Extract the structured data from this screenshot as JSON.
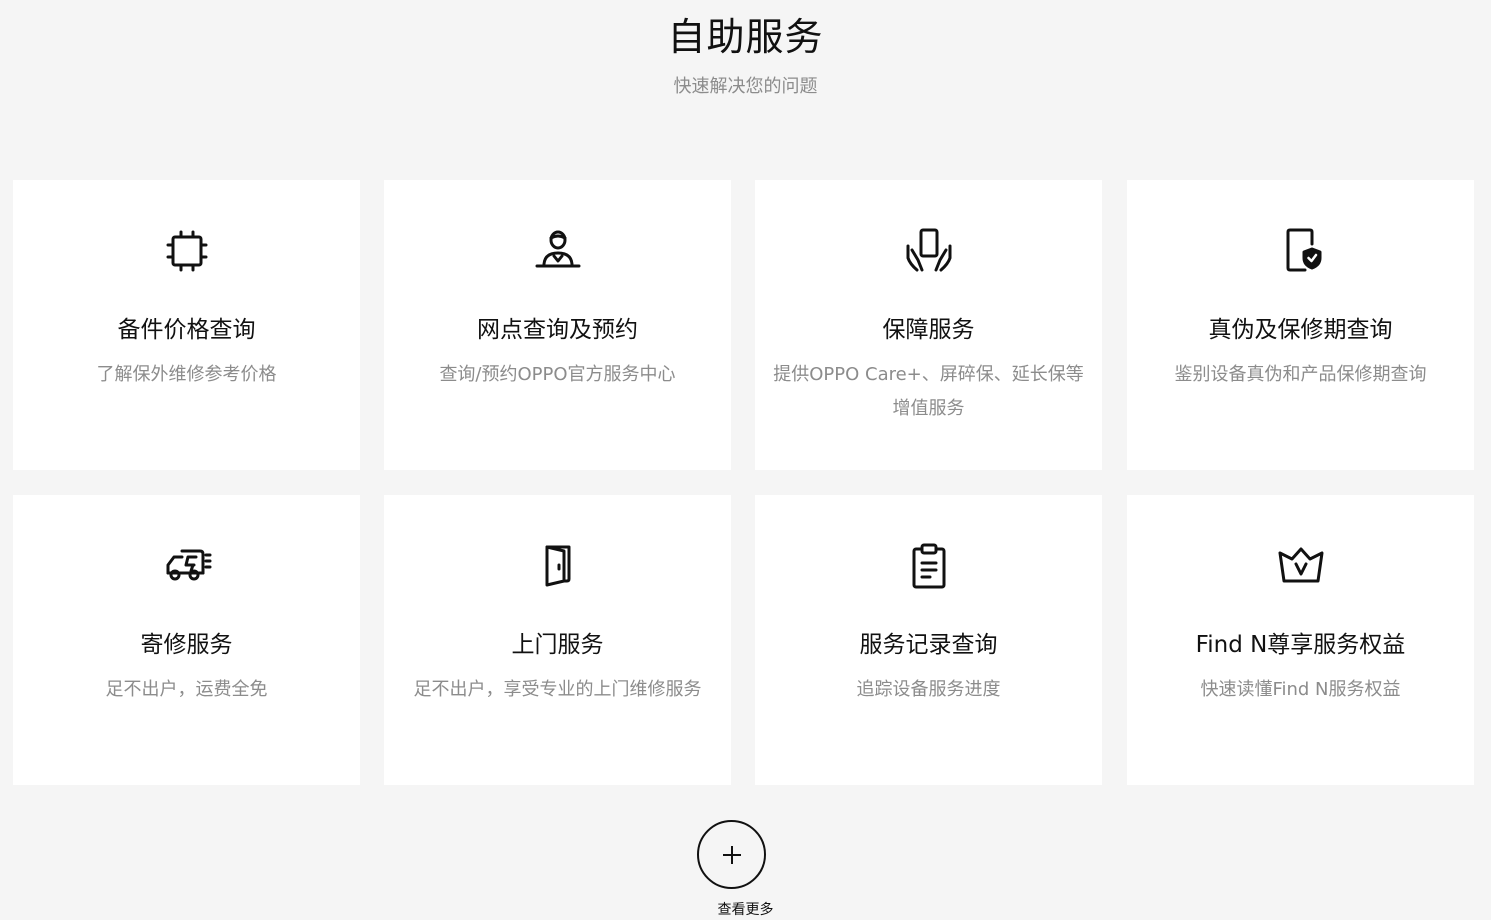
{
  "header": {
    "title": "自助服务",
    "subtitle": "快速解决您的问题"
  },
  "cards": [
    {
      "icon": "chip-icon",
      "title": "备件价格查询",
      "desc": "了解保外维修参考价格"
    },
    {
      "icon": "service-person-icon",
      "title": "网点查询及预约",
      "desc": "查询/预约OPPO官方服务中心"
    },
    {
      "icon": "hands-phone-icon",
      "title": "保障服务",
      "desc": "提供OPPO Care+、屏碎保、延长保等增值服务"
    },
    {
      "icon": "phone-shield-icon",
      "title": "真伪及保修期查询",
      "desc": "鉴别设备真伪和产品保修期查询"
    },
    {
      "icon": "delivery-truck-icon",
      "title": "寄修服务",
      "desc": "足不出户，运费全免"
    },
    {
      "icon": "door-icon",
      "title": "上门服务",
      "desc": "足不出户，享受专业的上门维修服务"
    },
    {
      "icon": "clipboard-icon",
      "title": "服务记录查询",
      "desc": "追踪设备服务进度"
    },
    {
      "icon": "crown-icon",
      "title": "Find N尊享服务权益",
      "desc": "快速读懂Find N服务权益"
    }
  ],
  "more": {
    "icon": "plus-icon",
    "label": "查看更多"
  }
}
